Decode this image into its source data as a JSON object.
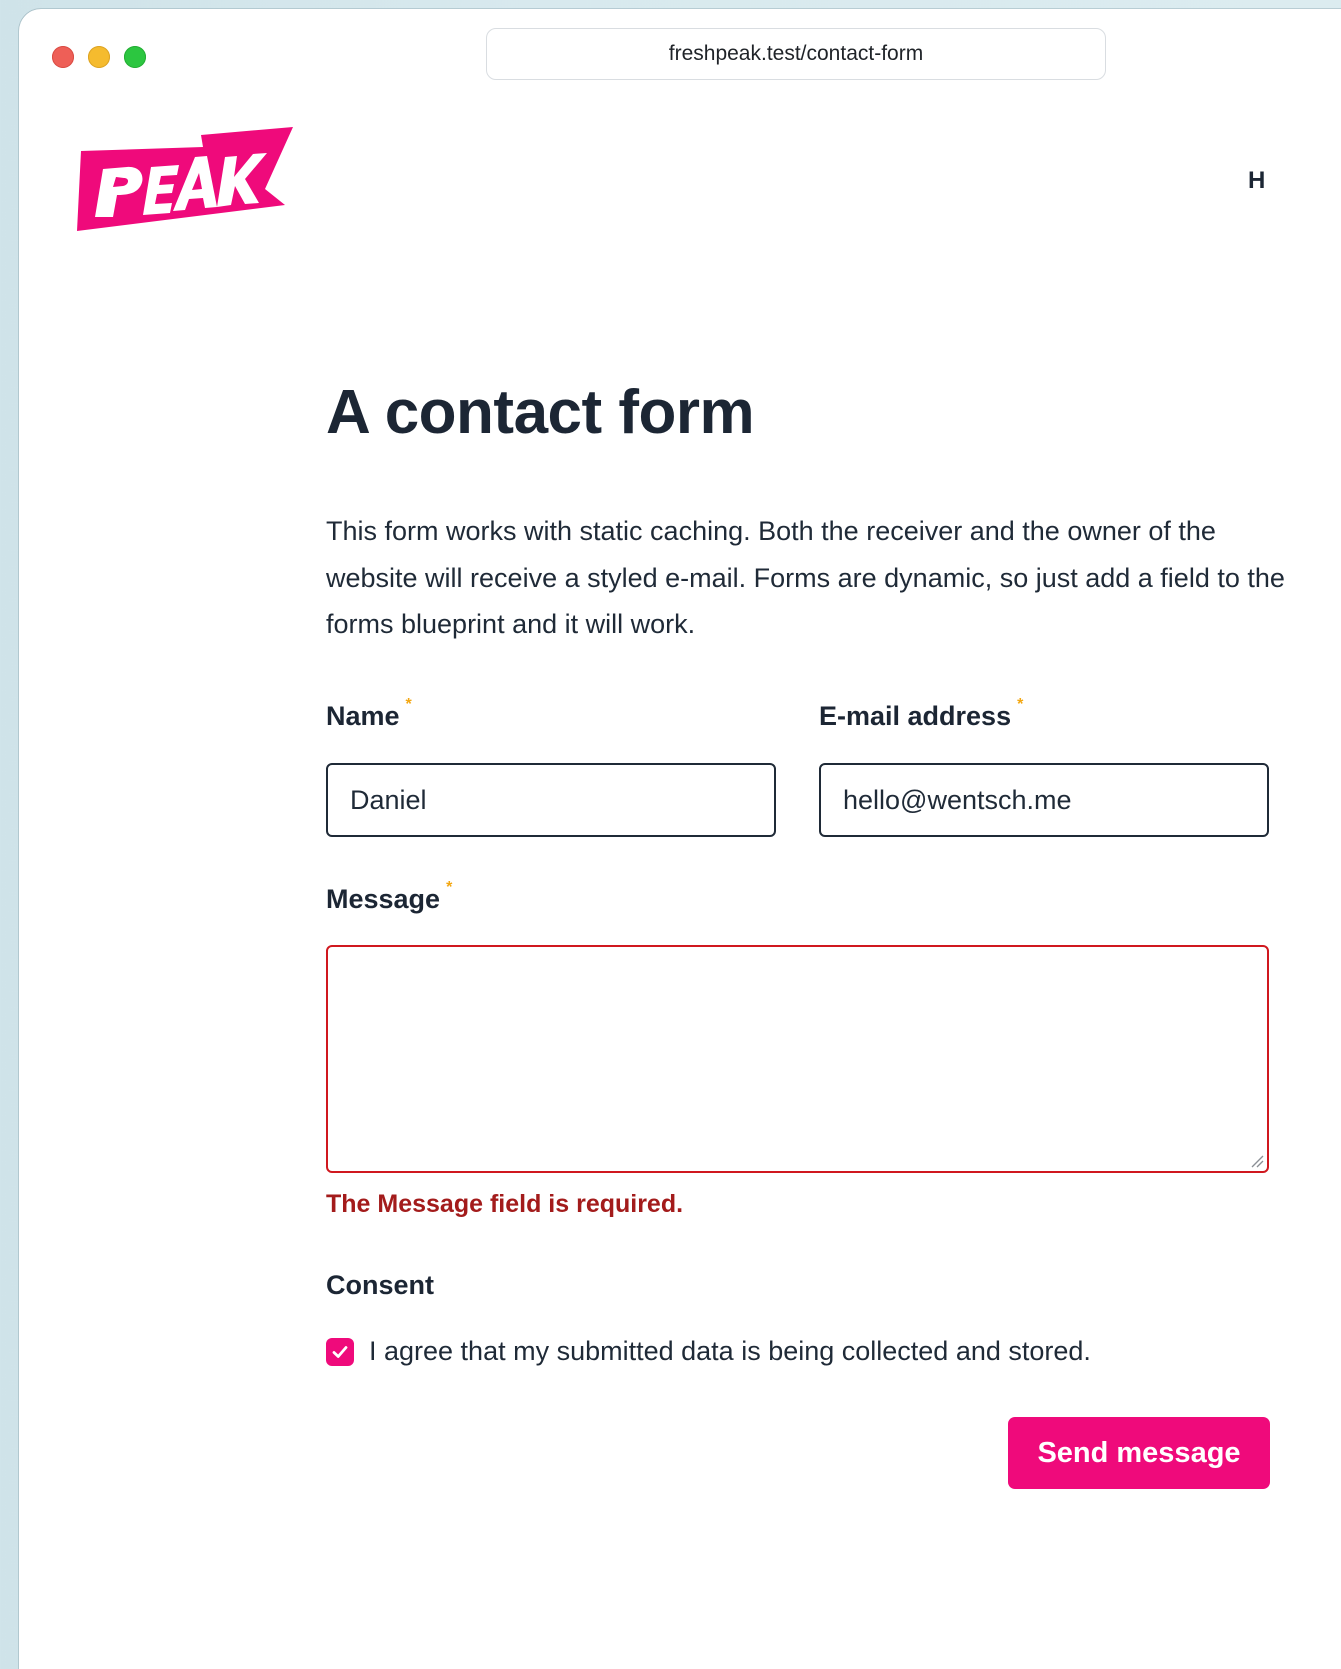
{
  "browser": {
    "url": "freshpeak.test/contact-form"
  },
  "site": {
    "logo_text": "PEAK",
    "nav_partial": "H",
    "brand_color": "#ef0a7b"
  },
  "page": {
    "title": "A contact form",
    "intro": "This form works with static caching. Both the receiver and the owner of the website will receive a styled e-mail. Forms are dynamic, so just add a field to the forms blueprint and it will work."
  },
  "form": {
    "name": {
      "label": "Name",
      "required_mark": "*",
      "value": "Daniel"
    },
    "email": {
      "label": "E-mail address",
      "required_mark": "*",
      "value": "hello@wentsch.me"
    },
    "message": {
      "label": "Message",
      "required_mark": "*",
      "value": "",
      "error": "The Message field is required.",
      "error_color": "#a31b1b"
    },
    "consent": {
      "label": "Consent",
      "checkbox_text": "I agree that my submitted data is being collected and stored.",
      "checked": true
    },
    "submit_label": "Send message"
  }
}
